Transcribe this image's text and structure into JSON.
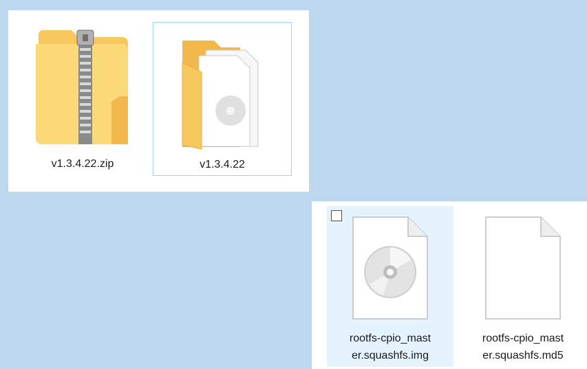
{
  "files": [
    {
      "name": "v1.3.4.22.zip",
      "type_icon": "zip-folder-icon"
    },
    {
      "name": "v1.3.4.22",
      "type_icon": "folder-icon"
    },
    {
      "name_line1": "rootfs-cpio_mast",
      "name_line2": "er.squashfs.img",
      "type_icon": "disc-image-icon",
      "selected": true
    },
    {
      "name_line1": "rootfs-cpio_mast",
      "name_line2": "er.squashfs.md5",
      "type_icon": "blank-file-icon"
    }
  ],
  "colors": {
    "desktop": "#bdd7ee",
    "folder": "#f7c85e",
    "hover_highlight": "#e5f3ff",
    "focus_border": "#99d1ff"
  }
}
